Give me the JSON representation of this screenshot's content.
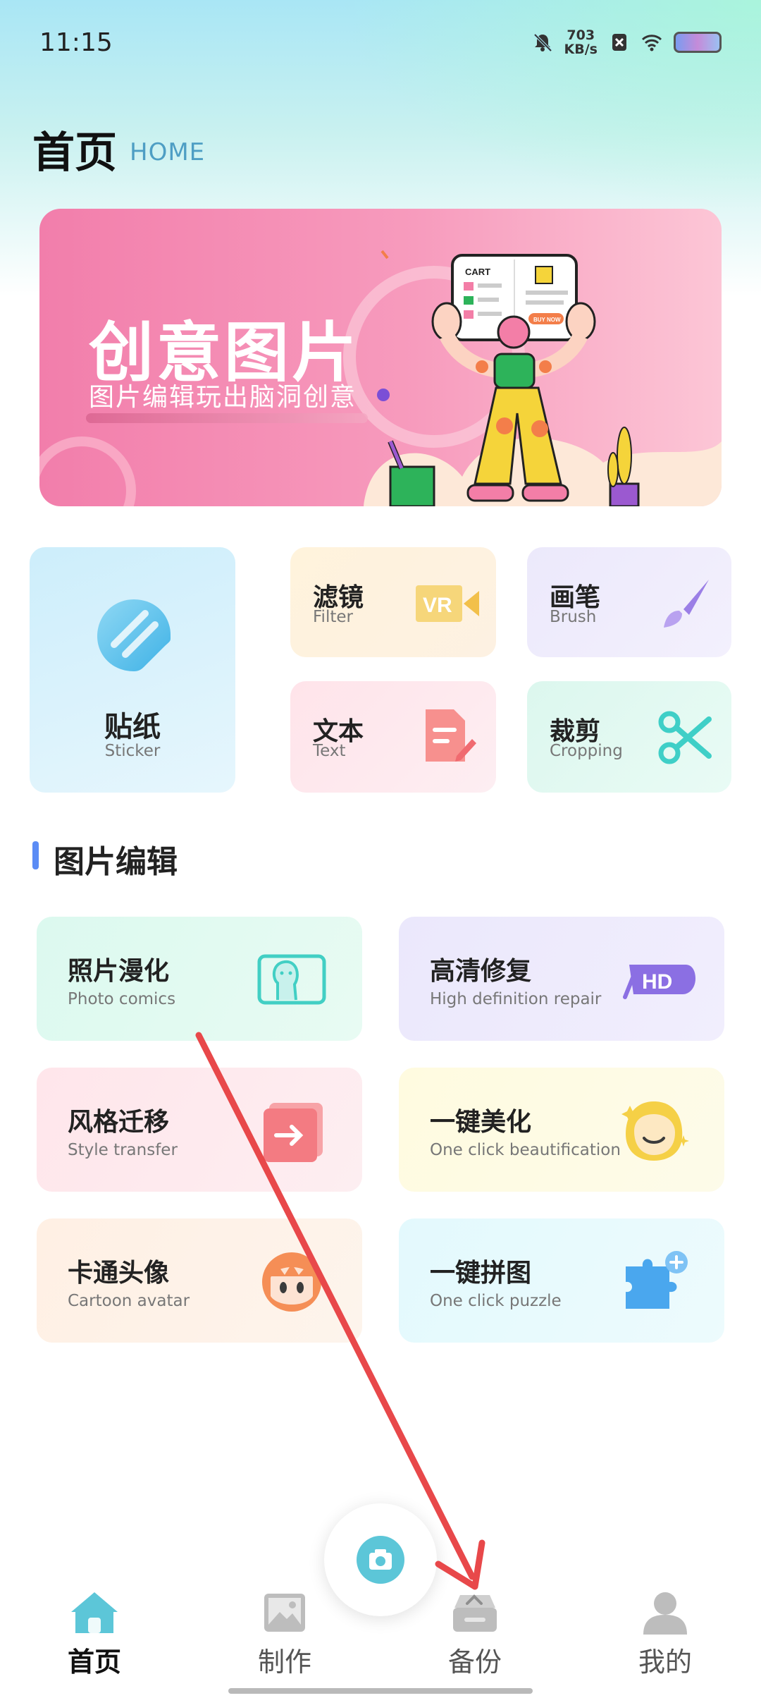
{
  "status_bar": {
    "time": "11:15",
    "net_speed_value": "703",
    "net_speed_unit": "KB/s"
  },
  "header": {
    "title": "首页",
    "subtitle": "HOME"
  },
  "banner": {
    "title": "创意图片",
    "subtitle": "图片编辑玩出脑洞创意",
    "cart_label": "CART",
    "buy_label": "BUY NOW"
  },
  "tools": {
    "sticker": {
      "title": "贴纸",
      "sub": "Sticker"
    },
    "filter": {
      "title": "滤镜",
      "sub": "Filter",
      "badge": "VR"
    },
    "brush": {
      "title": "画笔",
      "sub": "Brush"
    },
    "text": {
      "title": "文本",
      "sub": "Text"
    },
    "crop": {
      "title": "裁剪",
      "sub": "Cropping"
    }
  },
  "section": {
    "title": "图片编辑"
  },
  "edit_cards": [
    {
      "title": "照片漫化",
      "sub": "Photo comics"
    },
    {
      "title": "高清修复",
      "sub": "High definition repair",
      "badge": "HD"
    },
    {
      "title": "风格迁移",
      "sub": "Style transfer"
    },
    {
      "title": "一键美化",
      "sub": "One click beautification"
    },
    {
      "title": "卡通头像",
      "sub": "Cartoon avatar"
    },
    {
      "title": "一键拼图",
      "sub": "One click puzzle"
    }
  ],
  "bottom_nav": {
    "items": [
      {
        "label": "首页",
        "icon": "home-icon",
        "active": true
      },
      {
        "label": "制作",
        "icon": "image-icon",
        "active": false
      },
      {
        "label": "备份",
        "icon": "backup-icon",
        "active": false
      },
      {
        "label": "我的",
        "icon": "person-icon",
        "active": false
      }
    ],
    "center_icon": "camera-icon"
  },
  "colors": {
    "accent": "#5cc6d8",
    "annotation_arrow": "#e8484a",
    "section_bar": "#5b8cf5"
  }
}
